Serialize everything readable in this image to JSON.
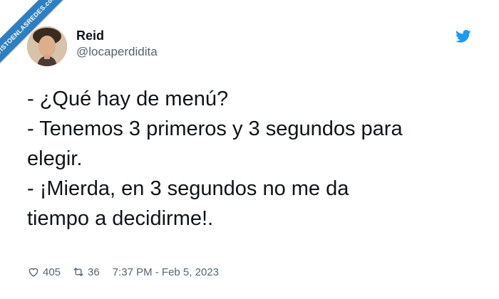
{
  "watermark": {
    "text": "VISTOENLASREDES",
    "suffix": ".com"
  },
  "author": {
    "name": "Reid",
    "handle": "@locaperdidita"
  },
  "tweet": {
    "text": "- ¿Qué hay de menú?\n- Tenemos 3 primeros y 3 segundos para\nelegir.\n- ¡Mierda, en 3 segundos no me da\ntiempo a decidirme!."
  },
  "stats": {
    "likes": "405",
    "retweets": "36",
    "timestamp": "7:37 PM - Feb 5, 2023"
  },
  "icons": {
    "brand": "twitter-bird-icon",
    "like": "heart-icon",
    "retweet": "retweet-icon"
  },
  "colors": {
    "brand": "#1d9bf0",
    "ribbon": "#2f7fc0",
    "text": "#0f1419",
    "secondary": "#536471"
  }
}
